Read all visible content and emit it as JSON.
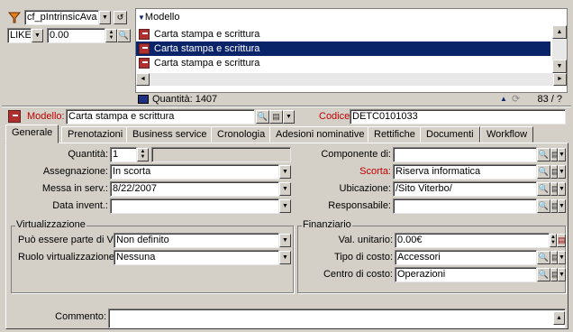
{
  "top": {
    "filter_field": "cf_pIntrinsicAva",
    "operator": "LIKE",
    "value": "0.00"
  },
  "list": {
    "header": "Modello",
    "rows": [
      "Carta stampa e scrittura",
      "Carta stampa e scrittura",
      "Carta stampa e scrittura"
    ],
    "count": "Quantità: 1407",
    "pager": "83 / ?"
  },
  "header": {
    "modello_label": "Modello:",
    "modello_value": "Carta stampa e scrittura",
    "codice_label": "Codice:",
    "codice_value": "DETC0101033"
  },
  "tabs": [
    "Generale",
    "Prenotazioni",
    "Business service",
    "Cronologia",
    "Adesioni nominative",
    "Rettifiche",
    "Documenti",
    "Workflow"
  ],
  "form": {
    "quantita_label": "Quantità:",
    "quantita_value": "1",
    "assegnazione_label": "Assegnazione:",
    "assegnazione_value": "In scorta",
    "messa_label": "Messa in serv.:",
    "messa_value": "8/22/2007",
    "data_inv_label": "Data invent.:",
    "data_inv_value": "",
    "componente_label": "Componente di:",
    "componente_value": "",
    "scorta_label": "Scorta:",
    "scorta_value": "Riserva informatica",
    "ubicazione_label": "Ubicazione:",
    "ubicazione_value": "/Sito Viterbo/",
    "responsabile_label": "Responsabile:",
    "responsabile_value": ""
  },
  "virt": {
    "title": "Virtualizzazione",
    "puo_label": "Può essere parte di VI:",
    "puo_value": "Non definito",
    "ruolo_label": "Ruolo virtualizzazione:",
    "ruolo_value": "Nessuna"
  },
  "fin": {
    "title": "Finanziario",
    "val_label": "Val. unitario:",
    "val_value": "0.00€",
    "tipo_label": "Tipo di costo:",
    "tipo_value": "Accessori",
    "centro_label": "Centro di costo:",
    "centro_value": "Operazioni"
  },
  "commento_label": "Commento:",
  "commento_value": ""
}
